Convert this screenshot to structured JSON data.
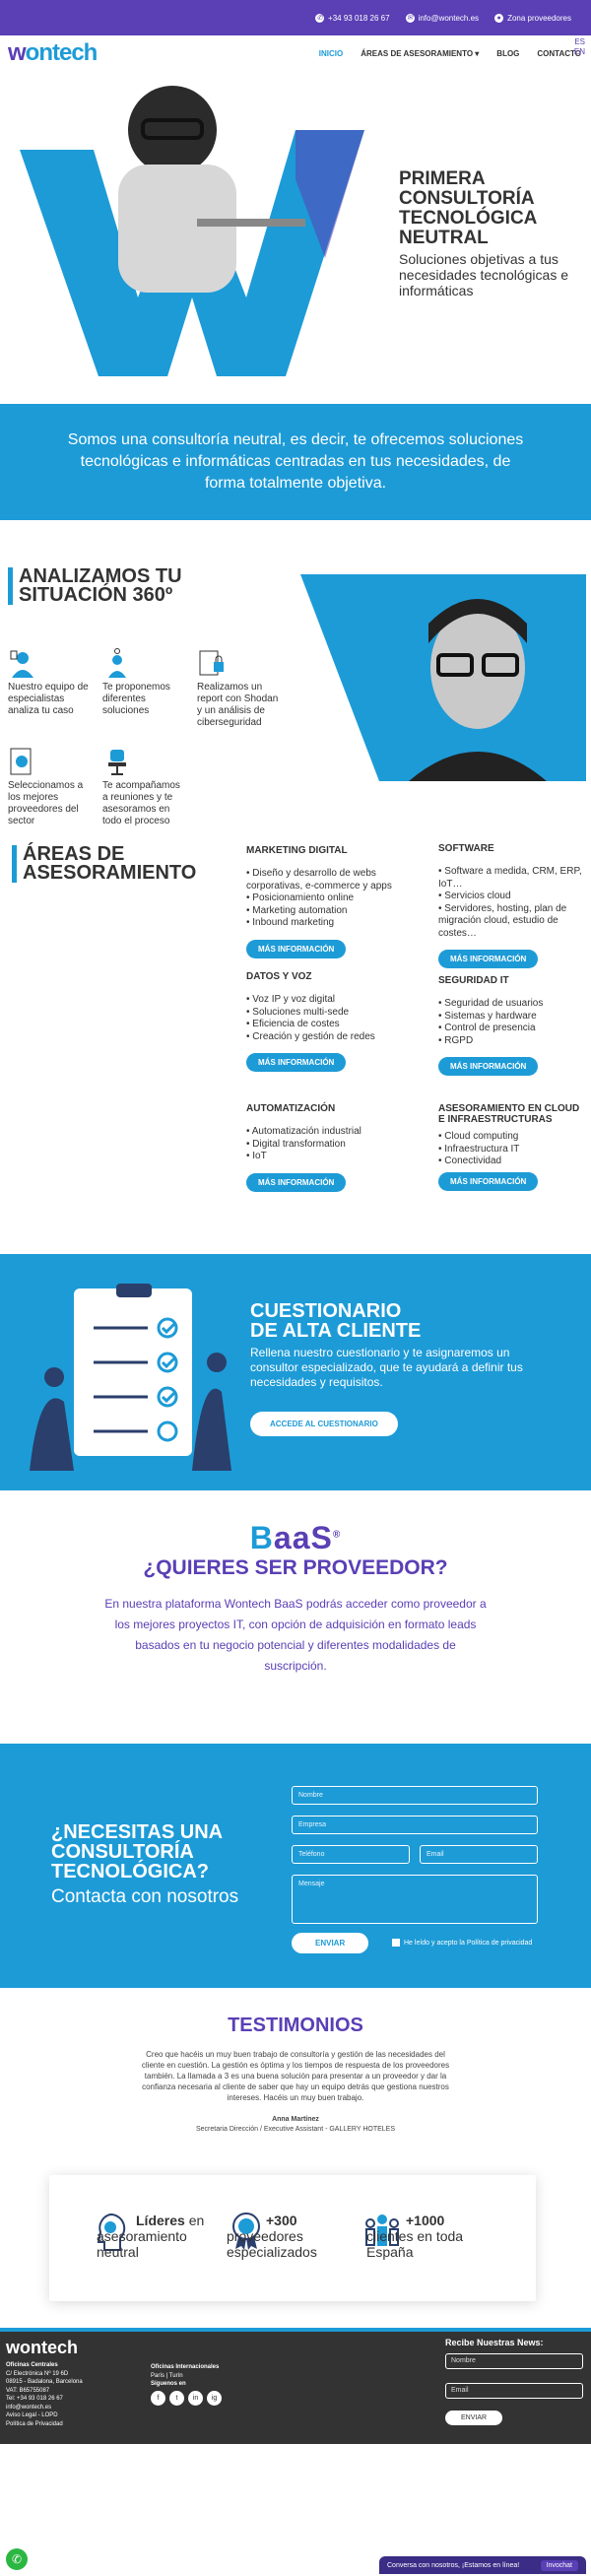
{
  "topbar": {
    "phone": "+34 93 018 26 67",
    "email": "info@wontech.es",
    "zone": "Zona proveedores"
  },
  "lang": [
    "ES",
    "EN"
  ],
  "header": {
    "logo_a": "w",
    "logo_b": "ontech",
    "nav": [
      "INICIO",
      "ÁREAS DE ASESORAMIENTO",
      "BLOG",
      "CONTACTO"
    ]
  },
  "hero": {
    "title": "PRIMERA\nCONSULTORÍA\nTECNOLÓGICA\nNEUTRAL",
    "subtitle": "Soluciones objetivas a tus necesidades tecnológicas e informáticas"
  },
  "band": {
    "text": "Somos una consultoría neutral, es decir, te ofrecemos soluciones tecnológicas e informáticas centradas en tus necesidades, de forma totalmente objetiva."
  },
  "analyze": {
    "title": "ANALIZAMOS TU SITUACIÓN 360º",
    "items": [
      {
        "icon": "expert-person-icon",
        "text": "Nuestro equipo de especialistas analiza tu caso"
      },
      {
        "icon": "idea-person-icon",
        "text": "Te proponemos diferentes soluciones"
      },
      {
        "icon": "security-report-icon",
        "text": "Realizamos un report con Shodan y un análisis de ciberseguridad"
      },
      {
        "icon": "document-search-icon",
        "text": "Seleccionamos a los mejores proveedores del sector"
      },
      {
        "icon": "meeting-chair-icon",
        "text": "Te acompañamos a reuniones y te asesoramos en todo el proceso"
      }
    ]
  },
  "areas": {
    "title": "ÁREAS DE ASESORAMIENTO",
    "button_label": "MÁS INFORMACIÓN",
    "cols": [
      {
        "title": "MARKETING DIGITAL",
        "items": [
          "Diseño y desarrollo de webs corporativas, e-commerce y apps",
          "Posicionamiento online",
          "Marketing automation",
          "Inbound marketing"
        ]
      },
      {
        "title": "SOFTWARE",
        "items": [
          "Software a medida, CRM, ERP, IoT…",
          "Servicios cloud",
          "Servidores, hosting, plan de migración cloud, estudio de costes…"
        ]
      },
      {
        "title": "DATOS Y VOZ",
        "items": [
          "Voz IP y voz digital",
          "Soluciones multi-sede",
          "Eficiencia de costes",
          "Creación y gestión de redes"
        ]
      },
      {
        "title": "SEGURIDAD IT",
        "items": [
          "Seguridad de usuarios",
          "Sistemas y hardware",
          "Control de presencia",
          "RGPD"
        ]
      },
      {
        "title": "AUTOMATIZACIÓN",
        "items": [
          "Automatización industrial",
          "Digital transformation",
          "IoT"
        ]
      },
      {
        "title": "ASESORAMIENTO EN CLOUD E INFRAESTRUCTURAS",
        "items": [
          "Cloud computing",
          "Infraestructura IT",
          "Conectividad"
        ]
      }
    ]
  },
  "quest": {
    "title": "CUESTIONARIO\nDE ALTA CLIENTE",
    "text": "Rellena nuestro cuestionario y te asignaremos un consultor especializado, que te ayudará a definir tus necesidades y requisitos.",
    "button": "ACCEDE AL CUESTIONARIO"
  },
  "baas": {
    "logo_a": "B",
    "logo_b": "aaS",
    "reg": "®",
    "title": "¿QUIERES SER PROVEEDOR?",
    "text": "En nuestra plataforma Wontech BaaS podrás acceder como proveedor a los mejores proyectos IT, con opción de adquisición en formato leads basados en tu negocio potencial y diferentes modalidades de suscripción."
  },
  "contact": {
    "title": "¿NECESITAS UNA\nCONSULTORÍA\nTECNOLÓGICA?",
    "subtitle": "Contacta con nosotros",
    "fields": {
      "name": "Nombre",
      "company": "Empresa",
      "phone": "Teléfono",
      "email": "Email",
      "message": "Mensaje"
    },
    "send": "ENVIAR",
    "privacy": "He leído y acepto la Política de privacidad"
  },
  "testimonials": {
    "title": "TESTIMONIOS",
    "quote": "Creo que hacéis un muy buen trabajo de consultoría y gestión de las necesidades del cliente en cuestión. La gestión es óptima y los tiempos de respuesta de los proveedores también. La llamada a 3 es una buena solución para presentar a un proveedor y dar la confianza necesaria al cliente de saber que hay un equipo detrás que gestiona nuestros intereses. Hacéis un muy buen trabajo.",
    "author": "Anna Martínez",
    "role": "Secretaria Dirección / Executive Assistant - GALLERY HOTELES"
  },
  "stats": [
    {
      "icon": "leader-head-icon",
      "bold": "Líderes",
      "rest": "en asesoramiento neutral"
    },
    {
      "icon": "medal-icon",
      "bold": "+300",
      "rest": "proveedores especializados"
    },
    {
      "icon": "people-group-icon",
      "bold": "+1000",
      "rest": "clientes en toda España"
    }
  ],
  "footer": {
    "logo": "wontech",
    "central": [
      "Oficinas Centrales",
      "C/ Electrónica Nº 19 6D",
      "08915 - Badalona, Barcelona",
      "VAT: B65755087",
      "Tel: +34 93 018 26 67",
      "info@wontech.es",
      "Aviso Legal - LOPD",
      "Política de Privacidad"
    ],
    "intl": [
      "Oficinas Internacionales",
      "París  |  Turín",
      "Síguenos en"
    ],
    "social": [
      "f",
      "t",
      "in",
      "ig"
    ],
    "newsletter": {
      "title": "Recibe Nuestras News:",
      "name": "Nombre",
      "email": "Email",
      "button": "ENVIAR"
    }
  },
  "chat": {
    "text": "Conversa con nosotros, ¡Estamos en línea!",
    "button": "Invochat"
  },
  "colors": {
    "blue": "#1d9bd7",
    "purple": "#5a3fb5",
    "dark": "#333333"
  }
}
